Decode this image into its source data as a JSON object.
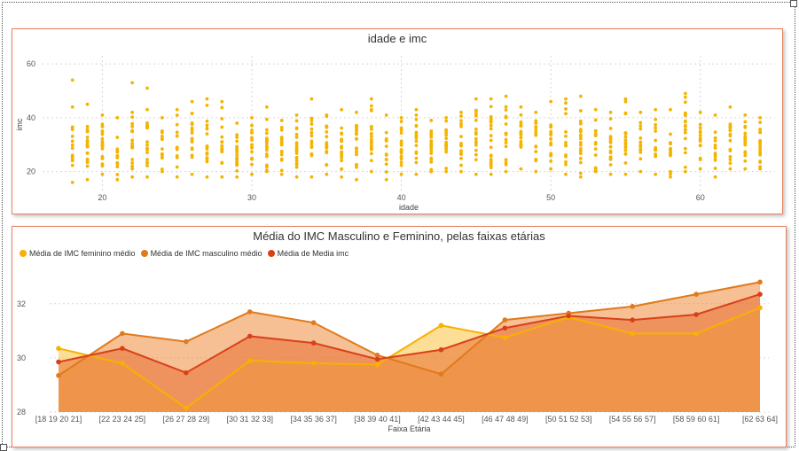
{
  "colors": {
    "panel_border": "#e8805f",
    "scatter_point": "#f4b400",
    "feminino": "#f9b000",
    "masculino": "#e07a1a",
    "media": "#d9401a",
    "grid": "#d6d6d6"
  },
  "chart_data": [
    {
      "type": "scatter",
      "title": "idade e imc",
      "xlabel": "idade",
      "ylabel": "imc",
      "xlim": [
        16,
        65
      ],
      "ylim": [
        12,
        63
      ],
      "xticks": [
        "20",
        "30",
        "40",
        "50",
        "60"
      ],
      "yticks": [
        "20",
        "40",
        "60"
      ],
      "grid": true,
      "point_color": "#f4b400",
      "columns": [
        {
          "x": 18,
          "min": 16,
          "max": 44,
          "outliers": [
            54
          ]
        },
        {
          "x": 19,
          "min": 17,
          "max": 45
        },
        {
          "x": 20,
          "min": 19,
          "max": 41
        },
        {
          "x": 21,
          "min": 17,
          "max": 40
        },
        {
          "x": 22,
          "min": 18,
          "max": 42,
          "outliers": [
            53
          ]
        },
        {
          "x": 23,
          "min": 18,
          "max": 43,
          "outliers": [
            51
          ]
        },
        {
          "x": 24,
          "min": 20,
          "max": 40
        },
        {
          "x": 25,
          "min": 18,
          "max": 43
        },
        {
          "x": 26,
          "min": 19,
          "max": 46
        },
        {
          "x": 27,
          "min": 18,
          "max": 47
        },
        {
          "x": 28,
          "min": 18,
          "max": 46
        },
        {
          "x": 29,
          "min": 18,
          "max": 38
        },
        {
          "x": 30,
          "min": 19,
          "max": 40
        },
        {
          "x": 31,
          "min": 20,
          "max": 44
        },
        {
          "x": 32,
          "min": 19,
          "max": 39
        },
        {
          "x": 33,
          "min": 18,
          "max": 41
        },
        {
          "x": 34,
          "min": 18,
          "max": 47
        },
        {
          "x": 35,
          "min": 19,
          "max": 41
        },
        {
          "x": 36,
          "min": 18,
          "max": 43
        },
        {
          "x": 37,
          "min": 17,
          "max": 42
        },
        {
          "x": 38,
          "min": 20,
          "max": 47
        },
        {
          "x": 39,
          "min": 17,
          "max": 41
        },
        {
          "x": 40,
          "min": 19,
          "max": 40
        },
        {
          "x": 41,
          "min": 19,
          "max": 43
        },
        {
          "x": 42,
          "min": 20,
          "max": 39
        },
        {
          "x": 43,
          "min": 20,
          "max": 40
        },
        {
          "x": 44,
          "min": 20,
          "max": 42
        },
        {
          "x": 45,
          "min": 19,
          "max": 47
        },
        {
          "x": 46,
          "min": 19,
          "max": 47
        },
        {
          "x": 47,
          "min": 20,
          "max": 48
        },
        {
          "x": 48,
          "min": 21,
          "max": 44
        },
        {
          "x": 49,
          "min": 20,
          "max": 42
        },
        {
          "x": 50,
          "min": 21,
          "max": 46
        },
        {
          "x": 51,
          "min": 19,
          "max": 47
        },
        {
          "x": 52,
          "min": 18,
          "max": 48
        },
        {
          "x": 53,
          "min": 20,
          "max": 43
        },
        {
          "x": 54,
          "min": 19,
          "max": 42
        },
        {
          "x": 55,
          "min": 19,
          "max": 47
        },
        {
          "x": 56,
          "min": 20,
          "max": 42
        },
        {
          "x": 57,
          "min": 19,
          "max": 43
        },
        {
          "x": 58,
          "min": 18,
          "max": 43
        },
        {
          "x": 59,
          "min": 20,
          "max": 49
        },
        {
          "x": 60,
          "min": 21,
          "max": 42
        },
        {
          "x": 61,
          "min": 18,
          "max": 41
        },
        {
          "x": 62,
          "min": 21,
          "max": 44
        },
        {
          "x": 63,
          "min": 21,
          "max": 41
        },
        {
          "x": 64,
          "min": 21,
          "max": 40
        }
      ]
    },
    {
      "type": "area",
      "title": "Média do IMC Masculino e Feminino, pelas faixas etárias",
      "xlabel": "Faixa Etária",
      "ylabel": "",
      "ylim": [
        28,
        33.4
      ],
      "yticks": [
        "28",
        "30",
        "32"
      ],
      "grid": true,
      "legend_position": "top-left",
      "categories": [
        "[18 19 20 21]",
        "[22 23 24 25]",
        "[26 27 28 29]",
        "[30 31 32 33]",
        "[34 35 36 37]",
        "[38 39 40 41]",
        "[42 43 44 45]",
        "[46 47 48 49]",
        "[50 51 52 53]",
        "[54 55 56 57]",
        "[58 59 60 61]",
        "[62 63 64]"
      ],
      "series": [
        {
          "name": "Média de IMC feminino médio",
          "color": "#f9b000",
          "values": [
            30.35,
            29.8,
            28.15,
            29.9,
            29.8,
            29.75,
            31.2,
            30.75,
            31.5,
            30.9,
            30.9,
            31.85
          ]
        },
        {
          "name": "Média de IMC masculino médio",
          "color": "#e07a1a",
          "values": [
            29.35,
            30.9,
            30.6,
            31.7,
            31.3,
            30.1,
            29.4,
            31.4,
            31.65,
            31.9,
            32.35,
            32.8
          ]
        },
        {
          "name": "Média de Media imc",
          "color": "#d9401a",
          "values": [
            29.85,
            30.35,
            29.45,
            30.8,
            30.55,
            29.95,
            30.3,
            31.1,
            31.55,
            31.4,
            31.6,
            32.35
          ]
        }
      ]
    }
  ]
}
